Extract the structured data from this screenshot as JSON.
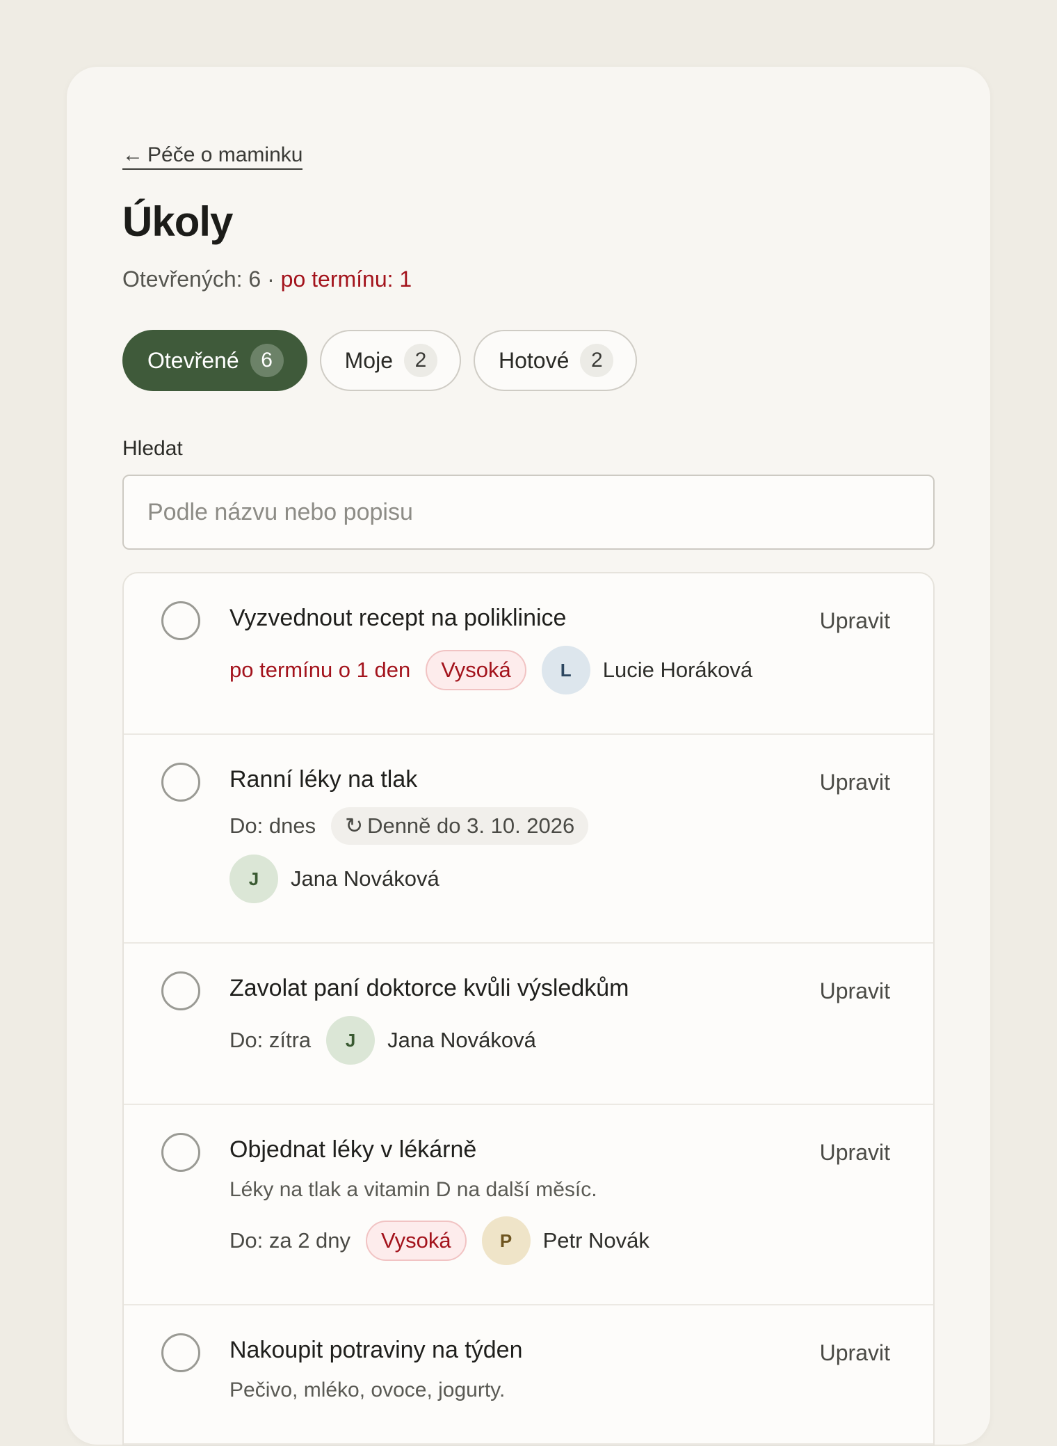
{
  "header": {
    "back_arrow": "←",
    "back_label": "Péče o maminku",
    "title": "Úkoly",
    "summary_open": "Otevřených: 6 · ",
    "summary_overdue": "po termínu: 1"
  },
  "filters": [
    {
      "label": "Otevřené",
      "count": "6",
      "active": true
    },
    {
      "label": "Moje",
      "count": "2",
      "active": false
    },
    {
      "label": "Hotové",
      "count": "2",
      "active": false
    }
  ],
  "search": {
    "label": "Hledat",
    "placeholder": "Podle názvu nebo popisu",
    "value": ""
  },
  "edit_label": "Upravit",
  "tasks": [
    {
      "title": "Vyzvednout recept na poliklinice",
      "due": "po termínu o 1 den",
      "priority": "Vysoká",
      "assignee_initial": "L",
      "assignee_name": "Lucie Horáková"
    },
    {
      "title": "Ranní léky na tlak",
      "due": "Do: dnes",
      "recur_icon": "↻",
      "recurrence": "Denně do 3. 10. 2026",
      "assignee_initial": "J",
      "assignee_name": "Jana Nováková"
    },
    {
      "title": "Zavolat paní doktorce kvůli výsledkům",
      "due": "Do: zítra",
      "assignee_initial": "J",
      "assignee_name": "Jana Nováková"
    },
    {
      "title": "Objednat léky v lékárně",
      "description": "Léky na tlak a vitamin D na další měsíc.",
      "due": "Do: za 2 dny",
      "priority": "Vysoká",
      "assignee_initial": "P",
      "assignee_name": "Petr Novák"
    },
    {
      "title": "Nakoupit potraviny na týden",
      "description": "Pečivo, mléko, ovoce, jogurty."
    }
  ],
  "colors": {
    "accent": "#3f5a3a",
    "overdue": "#a3131c",
    "background": "#efece4"
  }
}
